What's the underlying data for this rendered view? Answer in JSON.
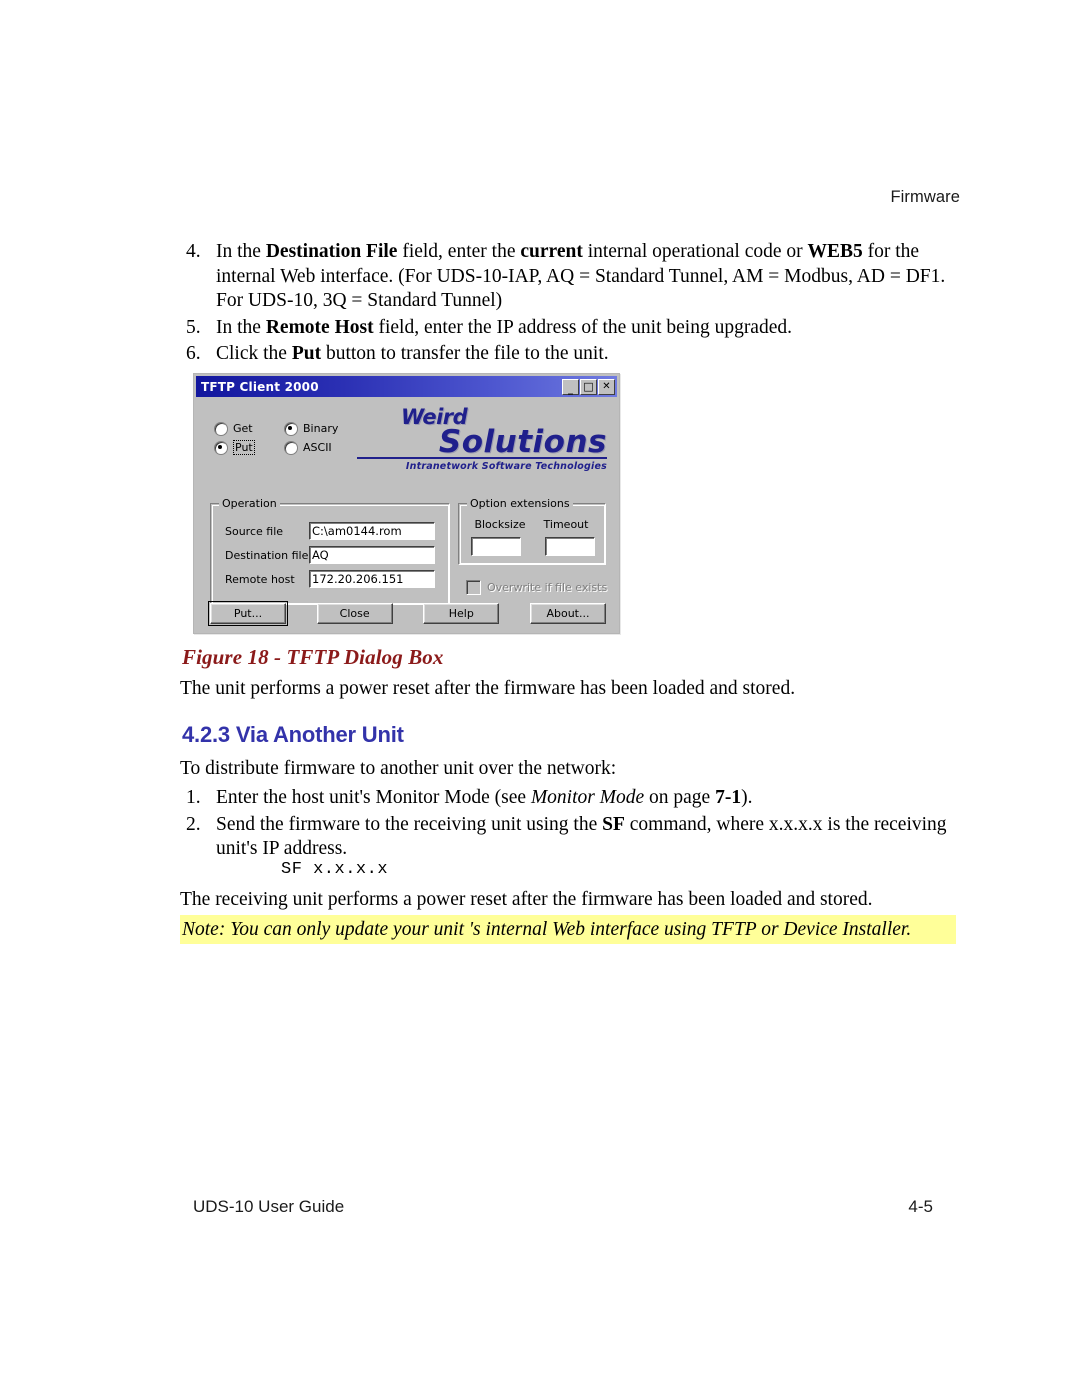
{
  "header": {
    "running_head": "Firmware"
  },
  "steps": [
    {
      "num": "4.",
      "segments": [
        {
          "t": "In the ",
          "style": "normal"
        },
        {
          "t": "Destination File",
          "style": "bold"
        },
        {
          "t": " field, enter the ",
          "style": "normal"
        },
        {
          "t": "current",
          "style": "bold"
        },
        {
          "t": " internal operational code or ",
          "style": "normal"
        },
        {
          "t": "WEB5",
          "style": "bold"
        },
        {
          "t": " for the internal Web interface. (For UDS-10-IAP, AQ = Standard Tunnel, AM = Modbus, AD = DF1. For UDS-10, 3Q = Standard Tunnel)",
          "style": "normal"
        }
      ]
    },
    {
      "num": "5.",
      "segments": [
        {
          "t": "In the ",
          "style": "normal"
        },
        {
          "t": "Remote Host",
          "style": "bold"
        },
        {
          "t": " field, enter the IP address of the unit being upgraded.",
          "style": "normal"
        }
      ]
    },
    {
      "num": "6.",
      "segments": [
        {
          "t": "Click the ",
          "style": "normal"
        },
        {
          "t": "Put",
          "style": "bold"
        },
        {
          "t": " button to transfer the file to the unit.",
          "style": "normal"
        }
      ]
    }
  ],
  "tftp_dialog": {
    "title": "TFTP Client 2000",
    "titlebar_buttons": [
      {
        "name": "minimize",
        "glyph": "_"
      },
      {
        "name": "maximize",
        "glyph": "□"
      },
      {
        "name": "close",
        "glyph": "✕"
      }
    ],
    "direction_radios": [
      {
        "label": "Get",
        "selected": false
      },
      {
        "label": "Put",
        "selected": true,
        "focused": true
      }
    ],
    "mode_radios": [
      {
        "label": "Binary",
        "selected": true
      },
      {
        "label": "ASCII",
        "selected": false
      }
    ],
    "logo": {
      "word1": "Weird",
      "word2": "Solutions",
      "tagline": "Intranetwork Software Technologies",
      "color": "#20208c"
    },
    "operation_group": {
      "title": "Operation",
      "fields": [
        {
          "label": "Source file",
          "value": "C:\\am0144.rom"
        },
        {
          "label": "Destination file",
          "value": "AQ"
        },
        {
          "label": "Remote host",
          "value": "172.20.206.151"
        }
      ]
    },
    "options_group": {
      "title": "Option extensions",
      "headers": [
        "Blocksize",
        "Timeout"
      ],
      "values": [
        "",
        ""
      ]
    },
    "overwrite_checkbox": {
      "label": "Overwrite if file exists",
      "checked": false,
      "disabled": true
    },
    "buttons": [
      {
        "label": "Put...",
        "default": true
      },
      {
        "label": "Close",
        "default": false
      },
      {
        "label": "Help",
        "default": false
      },
      {
        "label": "About...",
        "default": false
      }
    ]
  },
  "figure_caption": "Figure 18 - TFTP Dialog Box",
  "para_after_figure": "The unit performs a power reset after the firmware has been loaded and stored.",
  "heading_423": "4.2.3 Via Another Unit",
  "para_distribute": "To distribute firmware to another unit over the network:",
  "steps2": [
    {
      "num": "1.",
      "segments": [
        {
          "t": "Enter the host unit's Monitor Mode (see ",
          "style": "normal"
        },
        {
          "t": "Monitor Mode",
          "style": "italic"
        },
        {
          "t": " on page ",
          "style": "normal"
        },
        {
          "t": "7-1",
          "style": "bold"
        },
        {
          "t": ").",
          "style": "normal"
        }
      ]
    },
    {
      "num": "2.",
      "segments": [
        {
          "t": "Send the firmware to the receiving unit using the ",
          "style": "normal"
        },
        {
          "t": "SF",
          "style": "bold"
        },
        {
          "t": " command, where x.x.x.x is the receiving unit's IP address.",
          "style": "normal"
        }
      ]
    }
  ],
  "code_line": "SF x.x.x.x",
  "para_receiving": "The receiving unit performs a power reset after the firmware has been loaded and stored.",
  "note_text": "Note: You can only update your unit 's internal Web interface using TFTP or Device Installer.",
  "footer": {
    "left": "UDS-10 User Guide",
    "right": "4-5"
  }
}
